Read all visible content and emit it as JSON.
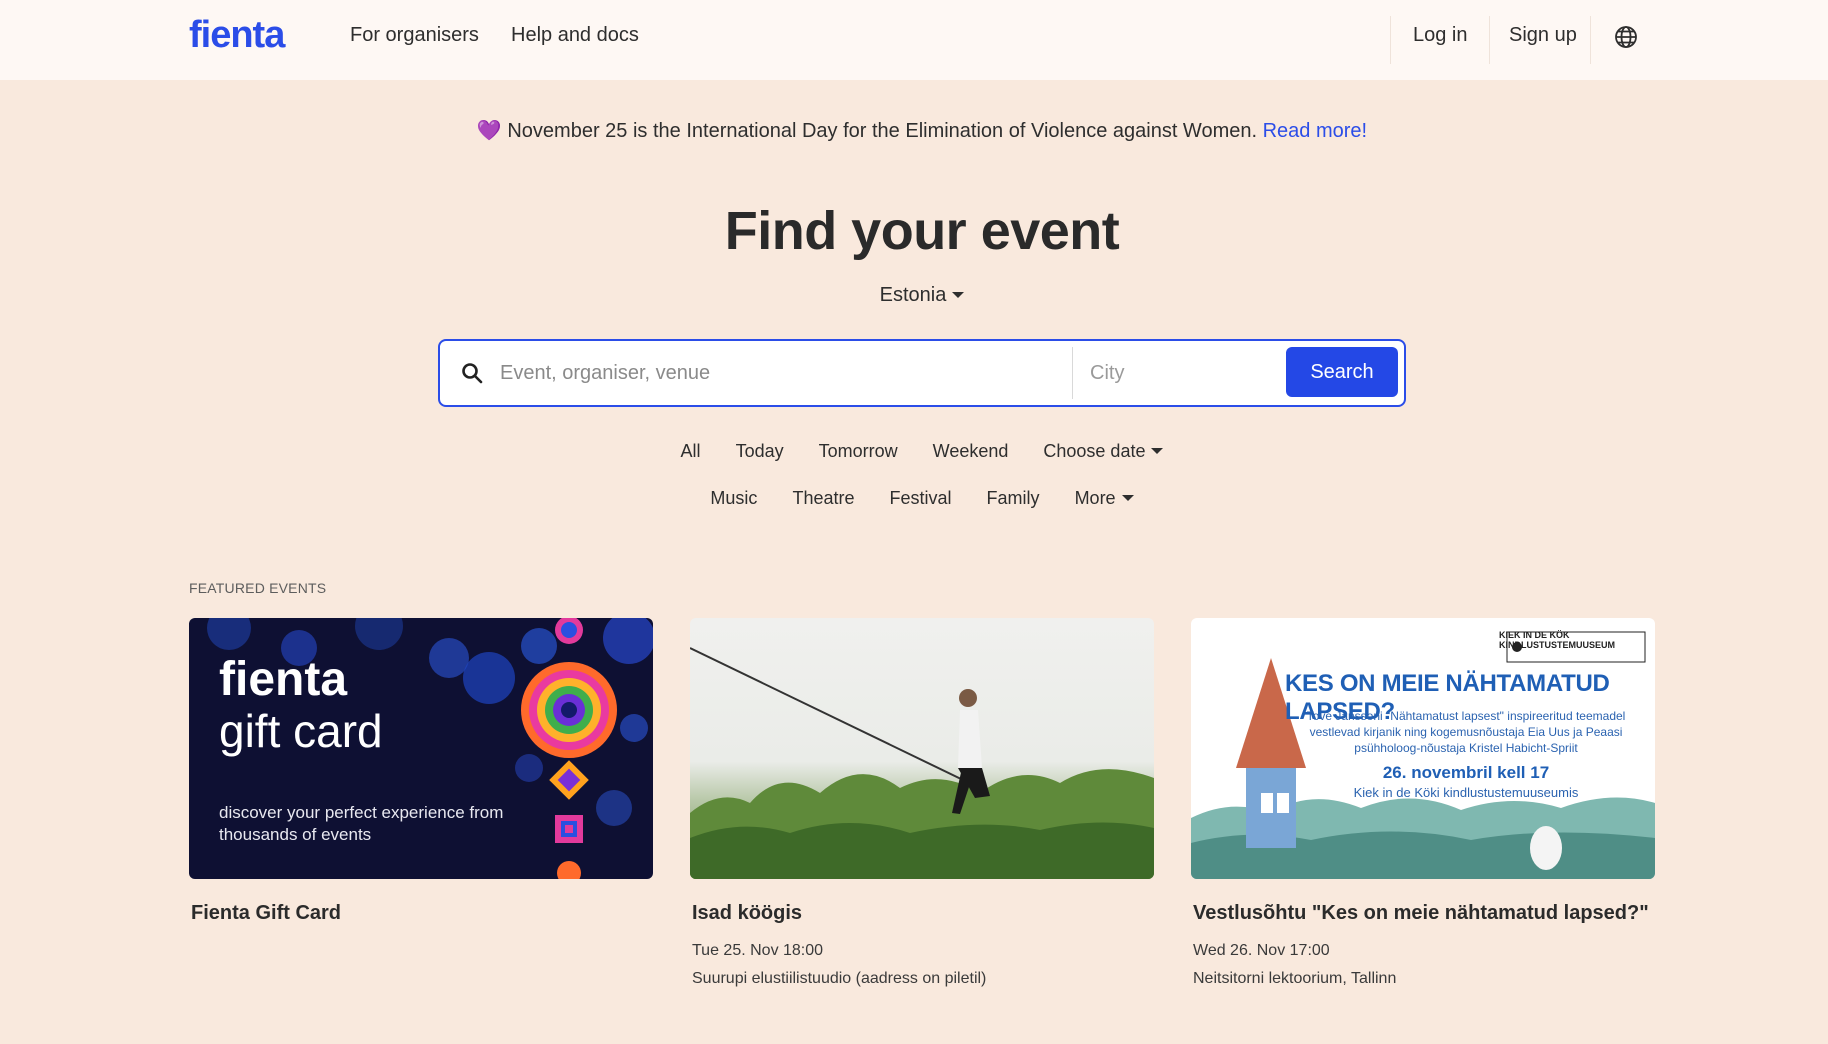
{
  "header": {
    "logo": "fienta",
    "nav": {
      "organisers": "For organisers",
      "help": "Help and docs"
    },
    "auth": {
      "login": "Log in",
      "signup": "Sign up"
    }
  },
  "announcement": {
    "heart": "💜",
    "text": "November 25 is the International Day for the Elimination of Violence against Women.",
    "link": "Read more!"
  },
  "hero": {
    "title": "Find your event",
    "country": "Estonia"
  },
  "search": {
    "event_placeholder": "Event, organiser, venue",
    "city_placeholder": "City",
    "button": "Search"
  },
  "filters": {
    "dates": [
      "All",
      "Today",
      "Tomorrow",
      "Weekend",
      "Choose date"
    ],
    "categories": [
      "Music",
      "Theatre",
      "Festival",
      "Family",
      "More"
    ]
  },
  "featured": {
    "label": "FEATURED EVENTS",
    "events": [
      {
        "title": "Fienta Gift Card",
        "image": {
          "brand": "fienta",
          "subtitle": "gift card",
          "tagline": "discover your perfect experience from thousands of events"
        }
      },
      {
        "title": "Isad köögis",
        "date": "Tue 25. Nov 18:00",
        "venue": "Suurupi elustiilistuudio (aadress on piletil)"
      },
      {
        "title": "Vestlusõhtu \"Kes on meie nähtamatud lapsed?\"",
        "date": "Wed 26. Nov 17:00",
        "venue": "Neitsitorni lektoorium, Tallinn",
        "image": {
          "logo_line1": "KIEK IN DE KÖK",
          "logo_line2": "KINDLUSTUSTEMUUSEUM",
          "headline": "KES ON MEIE NÄHTAMATUD LAPSED?",
          "text": "Tove Janssoni \"Nähtamatust lapsest\" inspireeritud teemadel vestlevad kirjanik ning kogemusnõustaja Eia Uus ja Peaasi psühholoog-nõustaja Kristel Habicht-Spriit",
          "date": "26. novembril kell 17",
          "place": "Kiek in de Köki kindlustustemuuseumis"
        }
      }
    ]
  },
  "colors": {
    "brand": "#2b4de8",
    "background": "#f9e9dd",
    "header_bg": "#fef8f4"
  }
}
